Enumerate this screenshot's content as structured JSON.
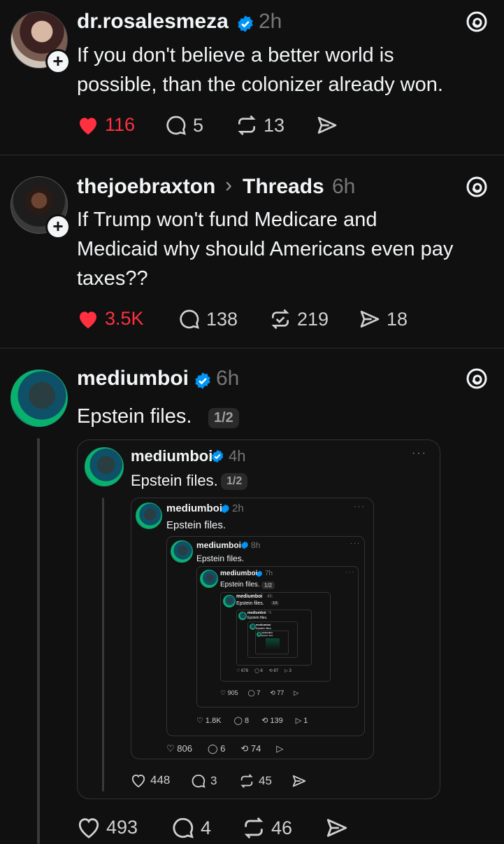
{
  "posts": [
    {
      "username": "dr.rosalesmeza",
      "time": "2h",
      "text_lines": [
        "If you don't believe a better world is",
        "possible, than the colonizer already won."
      ],
      "likes": "116",
      "replies": "5",
      "reposts": "13"
    },
    {
      "username": "thejoebraxton",
      "context_chevron": "›",
      "context": "Threads",
      "time": "6h",
      "text_lines": [
        "If Trump won't fund Medicare and",
        "Medicaid why should Americans even pay",
        "taxes??"
      ],
      "likes": "3.5K",
      "replies": "138",
      "reposts": "219",
      "shares": "18"
    },
    {
      "username": "mediumboi",
      "time": "6h",
      "text": "Epstein files.",
      "page_badge": "1/2",
      "likes": "493",
      "replies": "4",
      "reposts": "46"
    }
  ],
  "nested": [
    {
      "username": "mediumboi",
      "time": "4h",
      "text": "Epstein files.",
      "badge": "1/2",
      "likes": "448",
      "replies": "3",
      "reposts": "45"
    },
    {
      "username": "mediumboi",
      "time": "2h",
      "text": "Epstein files.",
      "likes": "806",
      "replies": "6",
      "reposts": "74"
    },
    {
      "username": "mediumboi",
      "time": "8h",
      "text": "Epstein files.",
      "likes": "1.8K",
      "replies": "8",
      "reposts": "139",
      "shares": "1"
    },
    {
      "username": "mediumboi",
      "time": "7h",
      "text": "Epstein files.",
      "badge": "1/2",
      "likes": "905",
      "replies": "7",
      "reposts": "77"
    },
    {
      "username": "mediumboi",
      "time": "4h",
      "text": "Epstein files.",
      "badge": "1/2",
      "likes": "678",
      "replies": "6",
      "reposts": "87",
      "shares": "3"
    },
    {
      "username": "mediumboi",
      "time": "7h",
      "text": "Epstein files."
    },
    {
      "username": "mediumboi",
      "text": "Epstein files."
    },
    {
      "username": "mediumboi",
      "text": "Epstein files."
    }
  ],
  "more_label": "···",
  "colors": {
    "like": "#ff3040",
    "verified": "#0095f6",
    "background": "#101010",
    "muted": "#777777"
  },
  "icons": [
    "heart-icon",
    "reply-icon",
    "repost-icon",
    "share-icon",
    "threads-icon",
    "verified-icon",
    "plus-icon",
    "more-icon"
  ]
}
